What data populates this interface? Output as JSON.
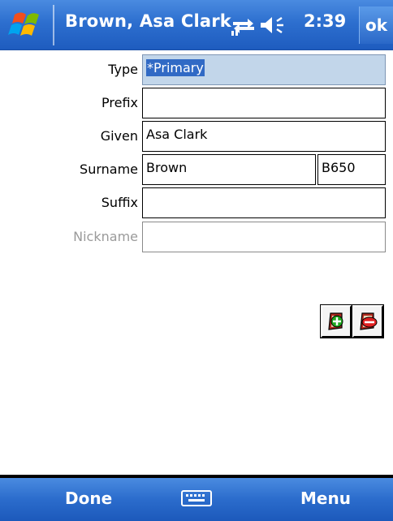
{
  "title_bar": {
    "title": "Brown, Asa Clark",
    "time": "2:39",
    "ok_label": "ok",
    "icons": [
      "windows-start-icon",
      "connectivity-icon",
      "speaker-icon"
    ]
  },
  "form": {
    "type": {
      "label": "Type",
      "value": "*Primary"
    },
    "prefix": {
      "label": "Prefix",
      "value": ""
    },
    "given": {
      "label": "Given",
      "value": "Asa Clark"
    },
    "surname": {
      "label": "Surname",
      "value": "Brown",
      "soundex": "B650"
    },
    "suffix": {
      "label": "Suffix",
      "value": ""
    },
    "nickname": {
      "label": "Nickname",
      "value": ""
    }
  },
  "actions": {
    "icons": [
      "add-name-icon",
      "delete-name-icon"
    ]
  },
  "softkeys": {
    "left": "Done",
    "right": "Menu",
    "center_icon": "keyboard-icon"
  },
  "colors": {
    "bar_blue": "#2d6fcf",
    "selection": "#316ac5",
    "type_field_bg": "#c2d6ea"
  }
}
